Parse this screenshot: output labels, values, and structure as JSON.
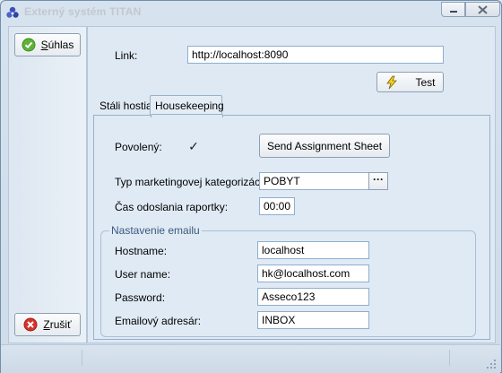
{
  "window": {
    "title": "Externý systém TITAN"
  },
  "left": {
    "suhlas_underlined": "S",
    "suhlas_rest": "úhlas",
    "zrusit_underlined": "Z",
    "zrusit_rest": "rušiť"
  },
  "main": {
    "link_label": "Link:",
    "link_value": "http://localhost:8090",
    "test_label": "Test",
    "tabs": [
      {
        "label": "Stáli hostia",
        "active": false
      },
      {
        "label": "Housekeeping",
        "active": true
      }
    ]
  },
  "housekeeping": {
    "povoleny_label": "Povolený:",
    "povoleny_checked": true,
    "send_button": "Send Assignment Sheet",
    "typ_label": "Typ marketingovej kategorizácie:",
    "typ_value": "POBYT",
    "cas_label": "Čas odoslania raportky:",
    "cas_value": "00:00",
    "email_group": "Nastavenie emailu",
    "hostname_label": "Hostname:",
    "hostname_value": "localhost",
    "user_label": "User name:",
    "user_value": "hk@localhost.com",
    "password_label": "Password:",
    "password_value": "Asseco123",
    "folder_label": "Emailový adresár:",
    "folder_value": "INBOX"
  },
  "colors": {
    "ok_green": "#5cb338",
    "cancel_red": "#d8322c",
    "accent_blue": "#3a5a80"
  }
}
